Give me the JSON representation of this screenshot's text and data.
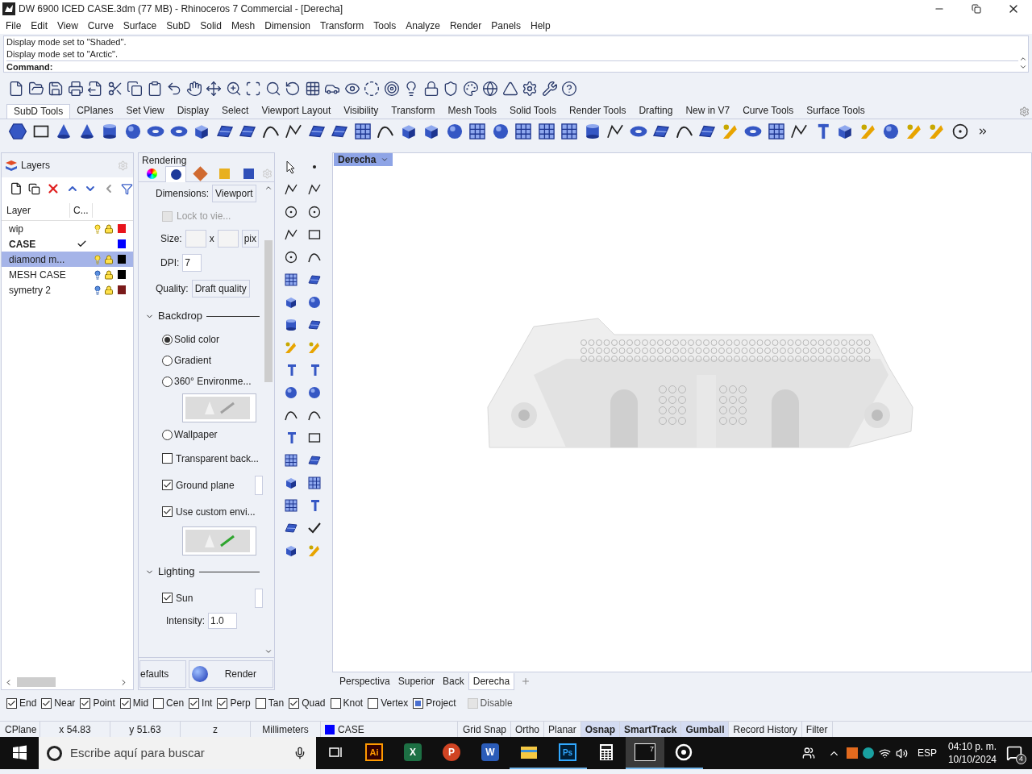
{
  "window": {
    "title": "DW 6900 ICED CASE.3dm (77 MB) - Rhinoceros 7 Commercial - [Derecha]"
  },
  "menu": [
    "File",
    "Edit",
    "View",
    "Curve",
    "Surface",
    "SubD",
    "Solid",
    "Mesh",
    "Dimension",
    "Transform",
    "Tools",
    "Analyze",
    "Render",
    "Panels",
    "Help"
  ],
  "command": {
    "history": [
      "Display mode set to \"Shaded\".",
      "Display mode set to \"Arctic\"."
    ],
    "prompt": "Command:"
  },
  "toolbar_tabs": [
    {
      "label": "SubD Tools",
      "selected": true
    },
    {
      "label": "CPlanes",
      "selected": false
    },
    {
      "label": "Set View",
      "selected": false
    },
    {
      "label": "Display",
      "selected": false
    },
    {
      "label": "Select",
      "selected": false
    },
    {
      "label": "Viewport Layout",
      "selected": false
    },
    {
      "label": "Visibility",
      "selected": false
    },
    {
      "label": "Transform",
      "selected": false
    },
    {
      "label": "Mesh Tools",
      "selected": false
    },
    {
      "label": "Solid Tools",
      "selected": false
    },
    {
      "label": "Render Tools",
      "selected": false
    },
    {
      "label": "Drafting",
      "selected": false
    },
    {
      "label": "New in V7",
      "selected": false
    },
    {
      "label": "Curve Tools",
      "selected": false
    },
    {
      "label": "Surface Tools",
      "selected": false
    }
  ],
  "layers": {
    "title": "Layers",
    "columns": [
      "Layer",
      "C..."
    ],
    "rows": [
      {
        "name": "wip",
        "current": false,
        "selected": false,
        "bulb_lit": true,
        "color": "#e8141c"
      },
      {
        "name": "CASE",
        "current": true,
        "selected": false,
        "color": "#0000ff"
      },
      {
        "name": "diamond m...",
        "current": false,
        "selected": true,
        "bulb_lit": true,
        "color": "#000000"
      },
      {
        "name": "MESH CASE",
        "current": false,
        "selected": false,
        "bulb_lit": false,
        "color": "#000000"
      },
      {
        "name": "symetry 2",
        "current": false,
        "selected": false,
        "bulb_lit": false,
        "color": "#7a1a1a"
      }
    ]
  },
  "rendering": {
    "title": "Rendering",
    "tabs": [
      {
        "selected": false
      },
      {
        "selected": true
      },
      {
        "selected": false
      },
      {
        "selected": false
      },
      {
        "selected": false
      }
    ],
    "dimensions": {
      "label": "Dimensions:",
      "value": "Viewport"
    },
    "lock": {
      "label": "Lock to vie...",
      "checked": false
    },
    "size": {
      "label": "Size:",
      "separator": "x",
      "unit": "pix"
    },
    "dpi": {
      "label": "DPI:",
      "value": "7"
    },
    "quality": {
      "label": "Quality:",
      "value": "Draft quality"
    },
    "sections": [
      {
        "title": "Backdrop",
        "expanded": true,
        "items": [
          {
            "kind": "radio",
            "label": "Solid color",
            "selected": true
          },
          {
            "kind": "radio",
            "label": "Gradient",
            "selected": false
          },
          {
            "kind": "radio",
            "label": "360° Environme...",
            "selected": false
          },
          {
            "kind": "preview",
            "pencil_lit": false
          },
          {
            "kind": "radio",
            "label": "Wallpaper",
            "selected": false
          },
          {
            "kind": "checkbox",
            "label": "Transparent back...",
            "checked": false,
            "has_button": false
          },
          {
            "kind": "checkbox",
            "label": "Ground plane",
            "checked": true,
            "has_button": true
          },
          {
            "kind": "checkbox",
            "label": "Use custom envi...",
            "checked": true,
            "has_button": false
          },
          {
            "kind": "preview",
            "pencil_lit": true
          }
        ]
      },
      {
        "title": "Lighting",
        "expanded": true,
        "items": [
          {
            "kind": "checkbox",
            "label": "Sun",
            "checked": true,
            "has_button": true
          },
          {
            "kind": "number",
            "label": "Intensity:",
            "value": "1.0"
          }
        ]
      }
    ],
    "buttons": [
      "efaults",
      "Render"
    ]
  },
  "viewport": {
    "title": "Derecha",
    "tabs": [
      {
        "label": "Perspectiva",
        "selected": false
      },
      {
        "label": "Superior",
        "selected": false
      },
      {
        "label": "Back",
        "selected": false
      },
      {
        "label": "Derecha",
        "selected": true
      }
    ]
  },
  "osnaps": [
    {
      "label": "End",
      "checked": true,
      "mixed": false,
      "disabled": false
    },
    {
      "label": "Near",
      "checked": true,
      "mixed": false,
      "disabled": false
    },
    {
      "label": "Point",
      "checked": true,
      "mixed": false,
      "disabled": false
    },
    {
      "label": "Mid",
      "checked": true,
      "mixed": false,
      "disabled": false
    },
    {
      "label": "Cen",
      "checked": false,
      "mixed": false,
      "disabled": false
    },
    {
      "label": "Int",
      "checked": true,
      "mixed": false,
      "disabled": false
    },
    {
      "label": "Perp",
      "checked": true,
      "mixed": false,
      "disabled": false
    },
    {
      "label": "Tan",
      "checked": false,
      "mixed": false,
      "disabled": false
    },
    {
      "label": "Quad",
      "checked": true,
      "mixed": false,
      "disabled": false
    },
    {
      "label": "Knot",
      "checked": false,
      "mixed": false,
      "disabled": false
    },
    {
      "label": "Vertex",
      "checked": false,
      "mixed": false,
      "disabled": false
    },
    {
      "label": "Project",
      "checked": false,
      "mixed": true,
      "disabled": false
    },
    {
      "label": "Disable",
      "checked": false,
      "mixed": false,
      "disabled": true
    }
  ],
  "status_bar": {
    "cplane": "CPlane",
    "x": "x 54.83",
    "y": "y 51.63",
    "z": "z",
    "units": "Millimeters",
    "layer": {
      "name": "CASE",
      "color": "#0000ff"
    },
    "toggles": [
      {
        "label": "Grid Snap",
        "on": false
      },
      {
        "label": "Ortho",
        "on": false
      },
      {
        "label": "Planar",
        "on": false
      },
      {
        "label": "Osnap",
        "on": true
      },
      {
        "label": "SmartTrack",
        "on": true
      },
      {
        "label": "Gumball",
        "on": true
      },
      {
        "label": "Record History",
        "on": false
      },
      {
        "label": "Filter",
        "on": false
      }
    ]
  },
  "taskbar": {
    "search_placeholder": "Escribe aquí para buscar",
    "apps": [
      {
        "kind": "taskview",
        "running": false,
        "active": false
      },
      {
        "kind": "illustrator",
        "label": "Ai",
        "running": false,
        "active": false
      },
      {
        "kind": "excel",
        "label": "X",
        "running": false,
        "active": false
      },
      {
        "kind": "powerpoint",
        "label": "P",
        "running": false,
        "active": false
      },
      {
        "kind": "word",
        "label": "W",
        "running": false,
        "active": false
      },
      {
        "kind": "explorer",
        "running": true,
        "active": false
      },
      {
        "kind": "photoshop",
        "label": "Ps",
        "running": true,
        "active": false
      },
      {
        "kind": "calculator",
        "running": false,
        "active": false
      },
      {
        "kind": "rhino",
        "label": "7",
        "running": true,
        "active": true
      },
      {
        "kind": "obs",
        "running": true,
        "active": false
      }
    ],
    "language": "ESP",
    "time": "04:10 p. m.",
    "date": "10/10/2024",
    "notifications": "4"
  }
}
